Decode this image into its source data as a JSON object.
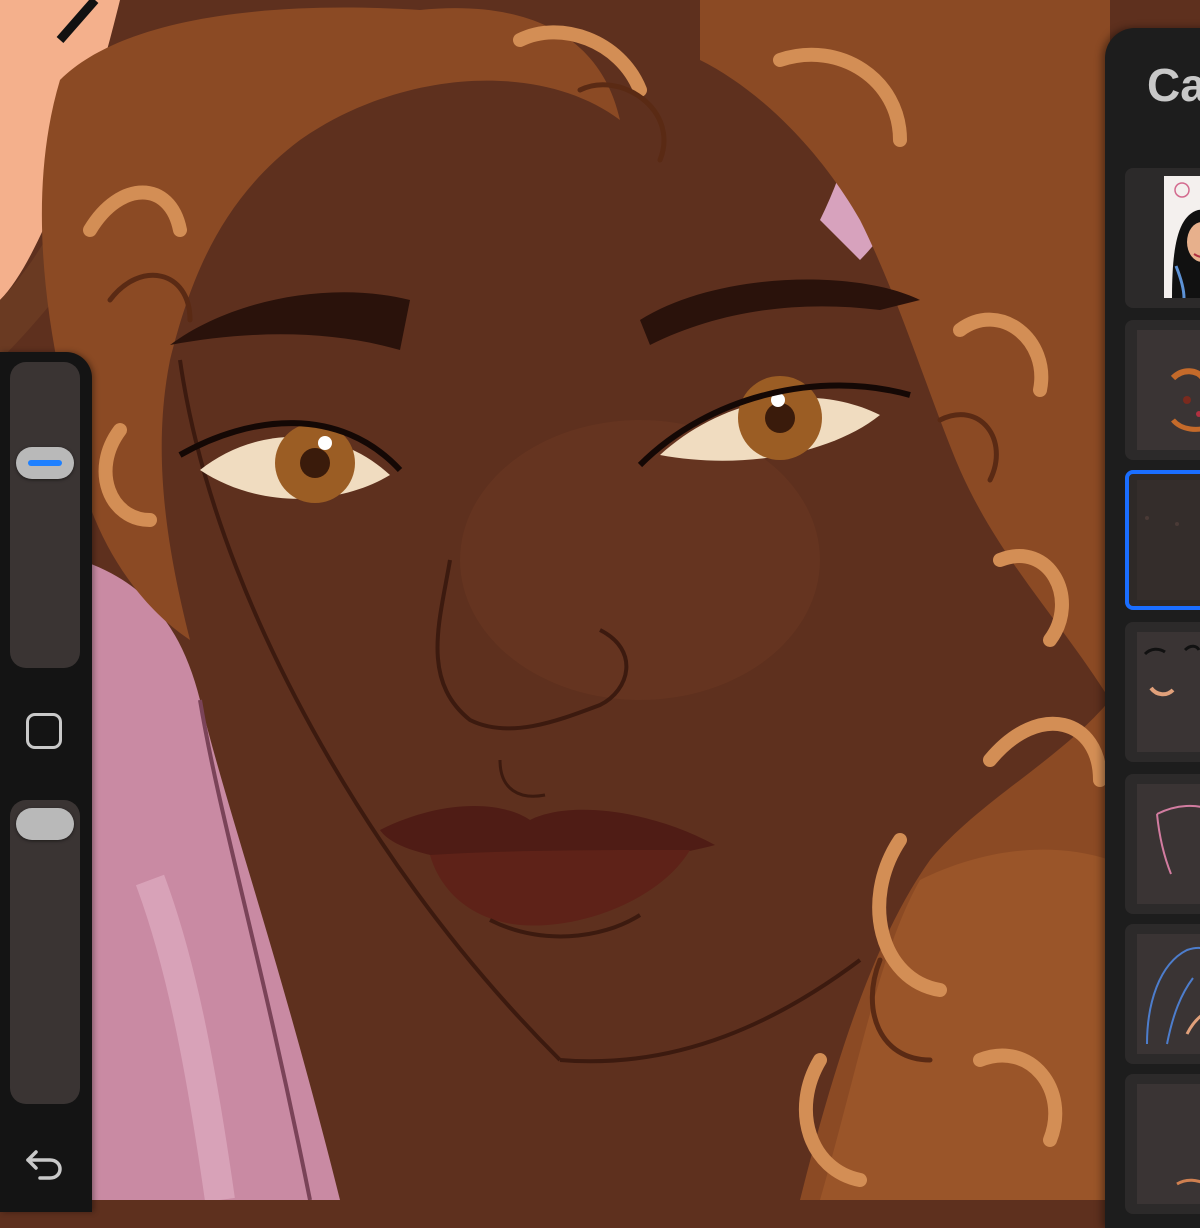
{
  "app": {
    "layers_panel_title": "Ca"
  },
  "sidebar": {
    "brush_size_slider": {
      "level_percent": 70
    },
    "modify_button_icon": "square-outline-icon",
    "opacity_slider": {
      "level_percent": 100
    },
    "undo_icon": "undo-arrow-icon"
  },
  "layers": {
    "count_visible": 7,
    "selected_index": 2,
    "accent_color": "#1a6eff"
  },
  "colors": {
    "skin": "#5e301e",
    "hair": "#a05a2a",
    "hair_highlight": "#d38e55",
    "jacket": "#c98aa3",
    "lips": "#4f1c15",
    "iris": "#9b5d24",
    "panel_bg": "#1d1d1d",
    "sidebar_bg": "#141414",
    "slider_thumb_accent": "#1e80ff"
  }
}
